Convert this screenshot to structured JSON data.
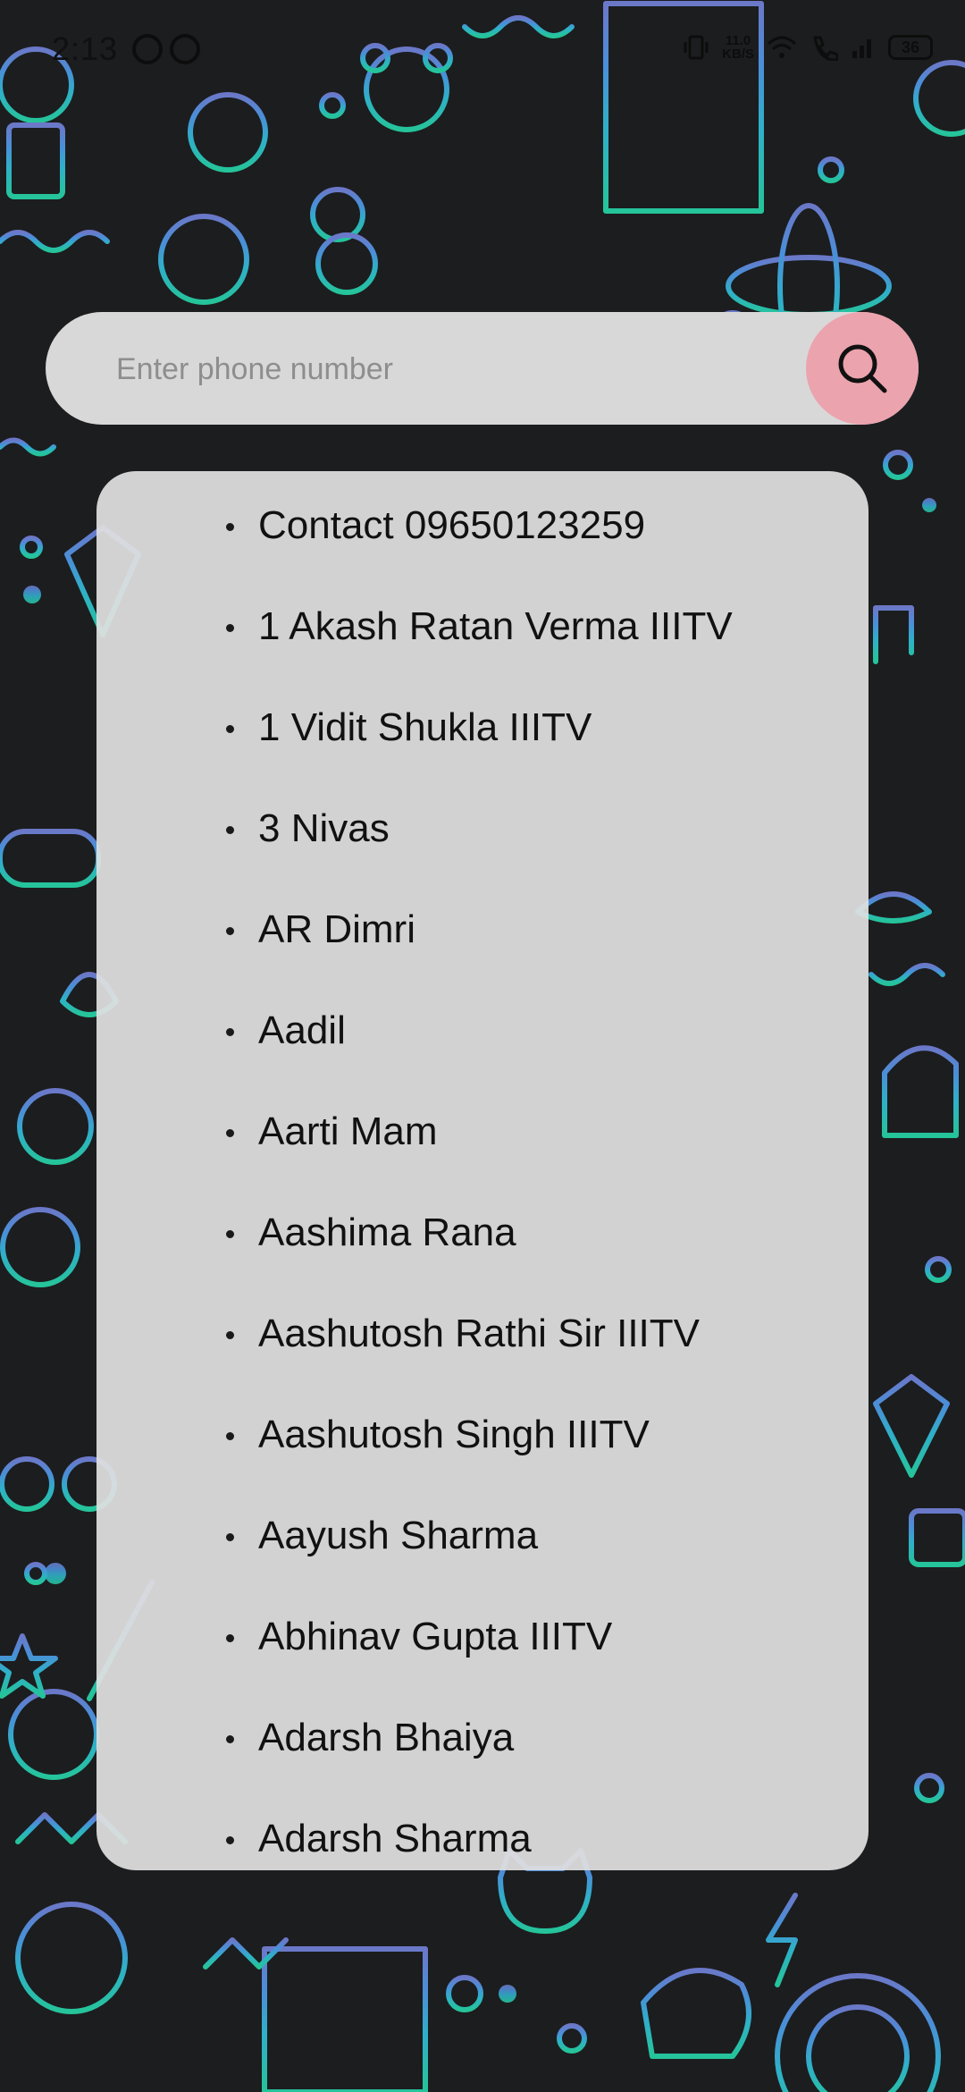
{
  "status_bar": {
    "time": "2:13",
    "net_speed_value": "11.0",
    "net_speed_unit": "KB/S",
    "battery": "36",
    "icons": [
      "whatsapp-icon",
      "app-notification-icon",
      "vibrate-icon",
      "wifi-icon",
      "volte-call-icon",
      "signal-icon",
      "battery-icon"
    ]
  },
  "search": {
    "placeholder": "Enter phone number",
    "value": "",
    "button_icon": "search-icon"
  },
  "contacts": [
    "Contact 09650123259",
    "1 Akash Ratan Verma IIITV",
    "1 Vidit Shukla IIITV",
    "3 Nivas",
    "AR Dimri",
    "Aadil",
    "Aarti Mam",
    "Aashima Rana",
    "Aashutosh Rathi Sir IIITV",
    "Aashutosh Singh IIITV",
    "Aayush Sharma",
    "Abhinav Gupta IIITV",
    "Adarsh Bhaiya",
    "Adarsh Sharma"
  ],
  "colors": {
    "background": "#1c1d1f",
    "search_bar": "#d8d8d8",
    "search_button": "#eba3ad",
    "card": "#e0e0e0"
  }
}
